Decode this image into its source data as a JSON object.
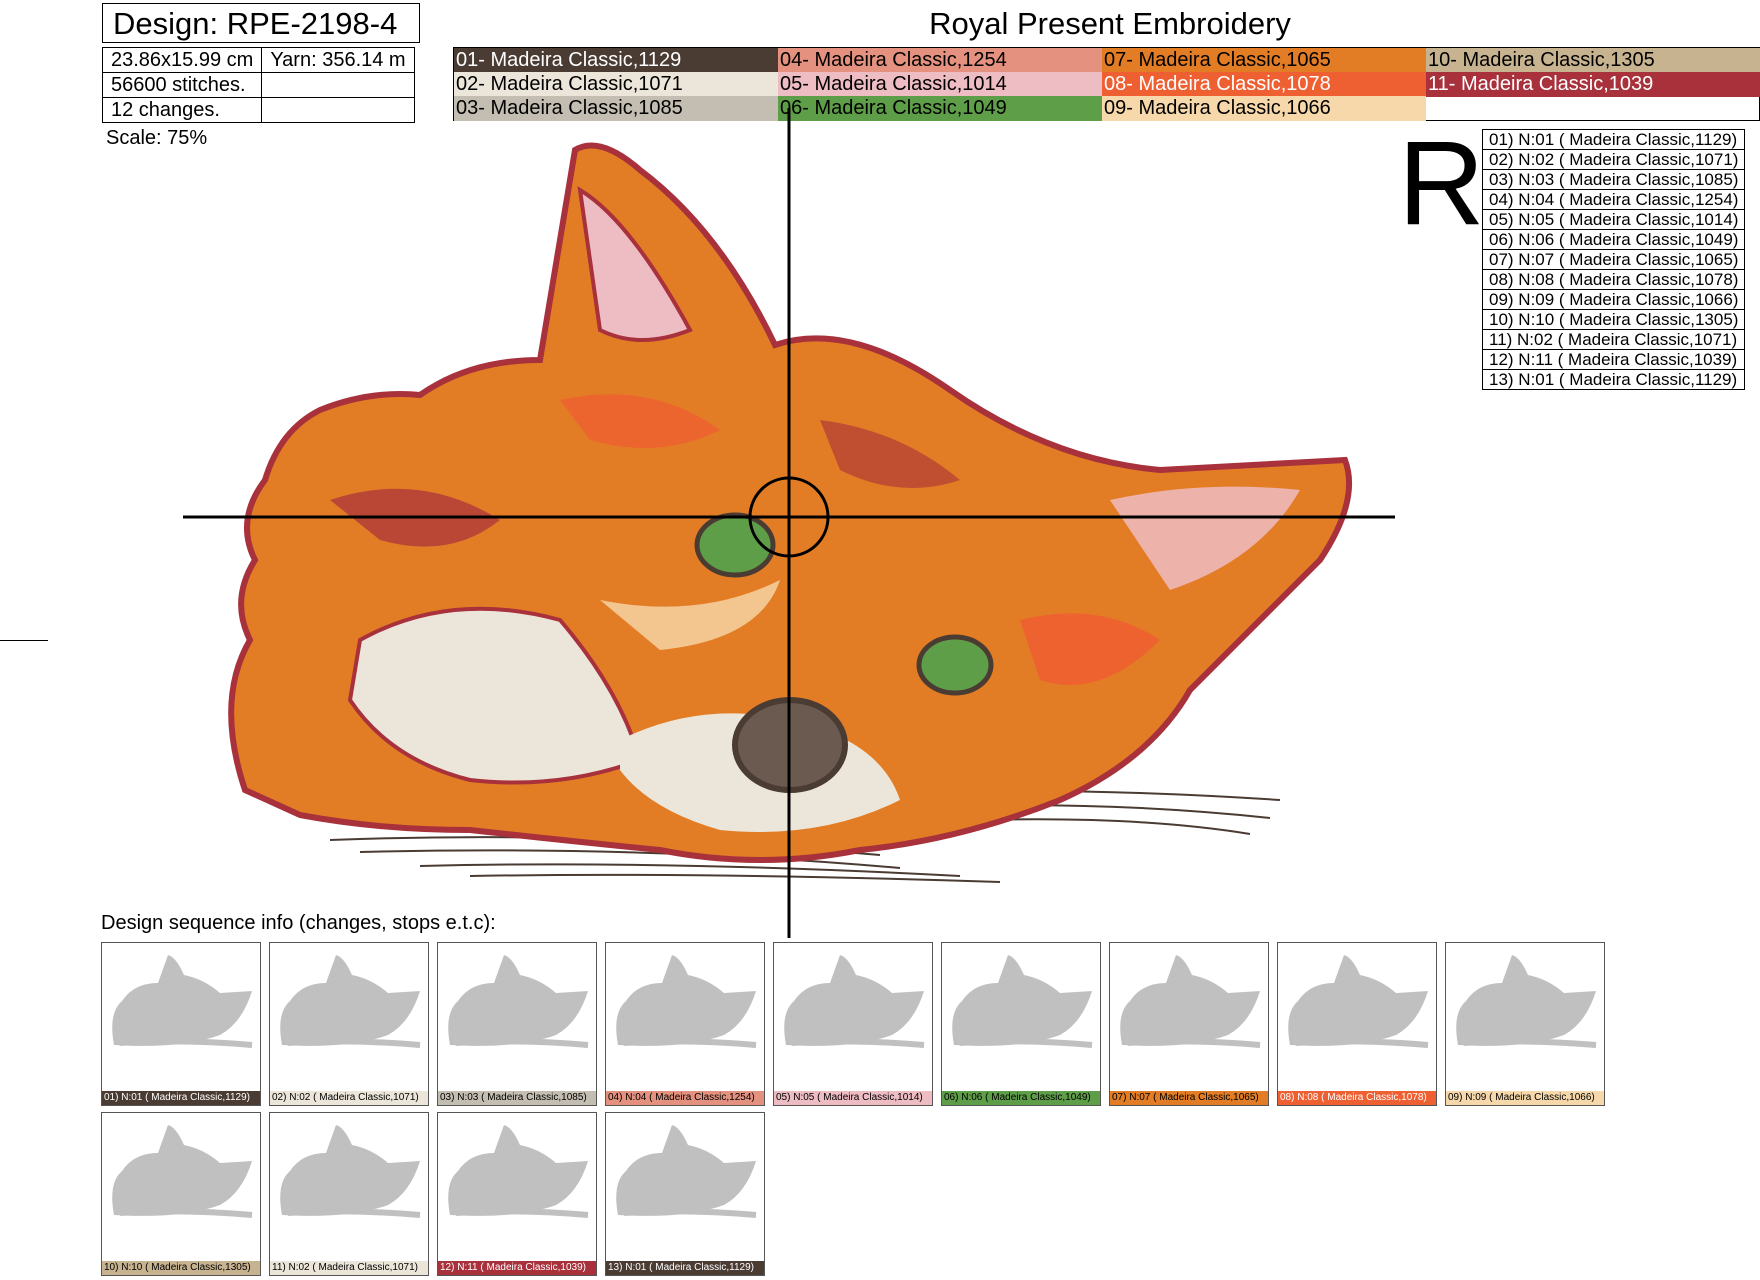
{
  "header": {
    "design_label": "Design: RPE-2198-4",
    "company": "Royal Present Embroidery"
  },
  "info": {
    "size": "23.86x15.99 cm",
    "yarn": "Yarn: 356.14 m",
    "stitches": "56600 stitches.",
    "changes": "12 changes."
  },
  "palette": [
    {
      "label": "01- Madeira Classic,1129",
      "color": "#4a3b33",
      "text": "#ffffff"
    },
    {
      "label": "02- Madeira Classic,1071",
      "color": "#ece6da",
      "text": "#000000"
    },
    {
      "label": "03- Madeira Classic,1085",
      "color": "#c4beb2",
      "text": "#000000"
    },
    {
      "label": "04- Madeira Classic,1254",
      "color": "#e5917f",
      "text": "#000000"
    },
    {
      "label": "05- Madeira Classic,1014",
      "color": "#eebcc3",
      "text": "#000000"
    },
    {
      "label": "06- Madeira Classic,1049",
      "color": "#5f9e48",
      "text": "#000000"
    },
    {
      "label": "07- Madeira Classic,1065",
      "color": "#e37d25",
      "text": "#000000"
    },
    {
      "label": "08- Madeira Classic,1078",
      "color": "#ee5f32",
      "text": "#ffffff"
    },
    {
      "label": "09- Madeira Classic,1066",
      "color": "#f6d8ab",
      "text": "#000000"
    },
    {
      "label": "10- Madeira Classic,1305",
      "color": "#c8b391",
      "text": "#000000"
    },
    {
      "label": "11- Madeira Classic,1039",
      "color": "#a8313c",
      "text": "#ffffff"
    }
  ],
  "scale": "Scale: 75%",
  "sequence_mark": "R",
  "sequence": [
    "01) N:01 ( Madeira Classic,1129)",
    "02) N:02 ( Madeira Classic,1071)",
    "03) N:03 ( Madeira Classic,1085)",
    "04) N:04 ( Madeira Classic,1254)",
    "05) N:05 ( Madeira Classic,1014)",
    "06) N:06 ( Madeira Classic,1049)",
    "07) N:07 ( Madeira Classic,1065)",
    "08) N:08 ( Madeira Classic,1078)",
    "09) N:09 ( Madeira Classic,1066)",
    "10) N:10 ( Madeira Classic,1305)",
    "11) N:02 ( Madeira Classic,1071)",
    "12) N:11 ( Madeira Classic,1039)",
    "13) N:01 ( Madeira Classic,1129)"
  ],
  "sequence_info_label": "Design sequence info (changes, stops e.t.c):",
  "thumbnails": [
    {
      "caption": "01) N:01 ( Madeira Classic,1129)",
      "color": "#4a3b33",
      "text": "#ffffff"
    },
    {
      "caption": "02) N:02 ( Madeira Classic,1071)",
      "color": "#ece6da",
      "text": "#000000"
    },
    {
      "caption": "03) N:03 ( Madeira Classic,1085)",
      "color": "#c4beb2",
      "text": "#000000"
    },
    {
      "caption": "04) N:04 ( Madeira Classic,1254)",
      "color": "#e5917f",
      "text": "#000000"
    },
    {
      "caption": "05) N:05 ( Madeira Classic,1014)",
      "color": "#eebcc3",
      "text": "#000000"
    },
    {
      "caption": "06) N:06 ( Madeira Classic,1049)",
      "color": "#5f9e48",
      "text": "#000000"
    },
    {
      "caption": "07) N:07 ( Madeira Classic,1065)",
      "color": "#e37d25",
      "text": "#000000"
    },
    {
      "caption": "08) N:08 ( Madeira Classic,1078)",
      "color": "#ee5f32",
      "text": "#ffffff"
    },
    {
      "caption": "09) N:09 ( Madeira Classic,1066)",
      "color": "#f6d8ab",
      "text": "#000000"
    },
    {
      "caption": "10) N:10 ( Madeira Classic,1305)",
      "color": "#c8b391",
      "text": "#000000"
    },
    {
      "caption": "11) N:02 ( Madeira Classic,1071)",
      "color": "#ece6da",
      "text": "#000000"
    },
    {
      "caption": "12) N:11 ( Madeira Classic,1039)",
      "color": "#a8313c",
      "text": "#ffffff"
    },
    {
      "caption": "13) N:01 ( Madeira Classic,1129)",
      "color": "#4a3b33",
      "text": "#ffffff"
    }
  ]
}
